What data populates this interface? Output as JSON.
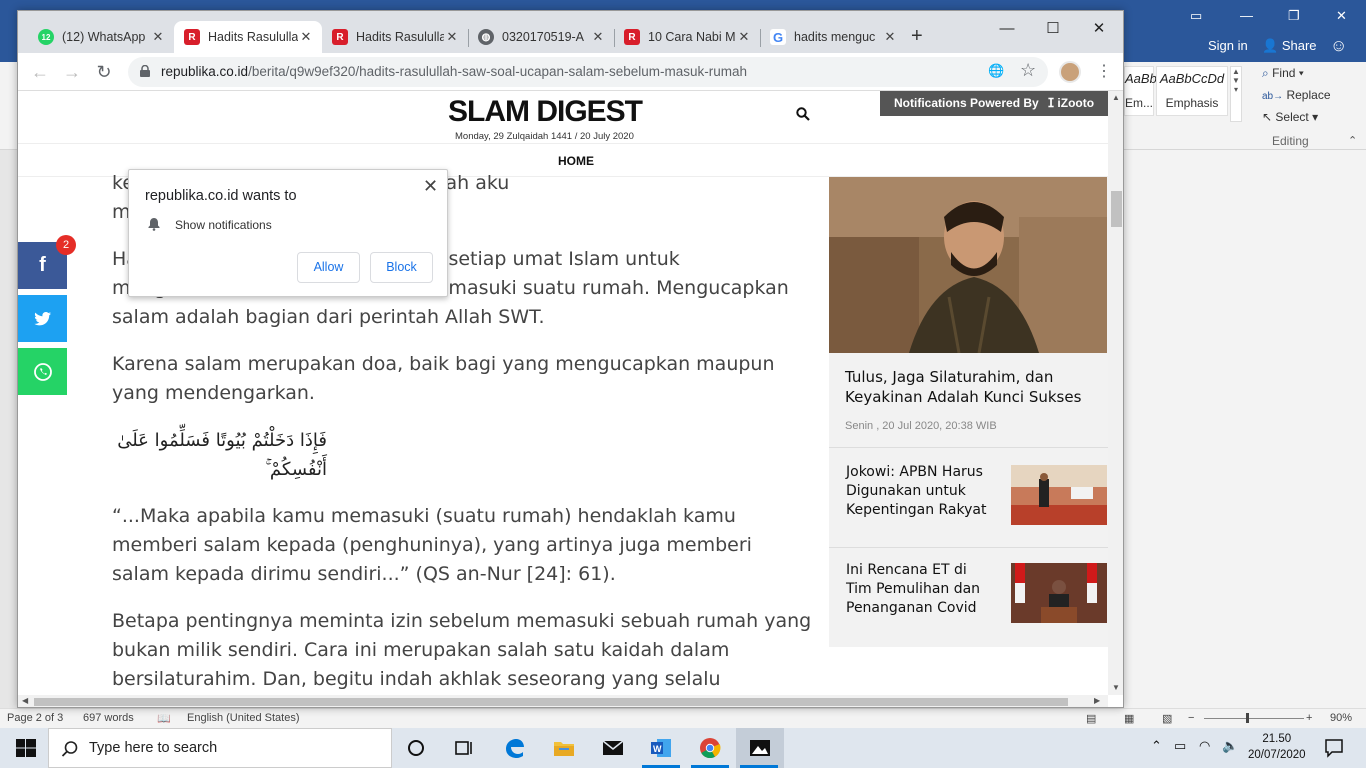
{
  "word": {
    "signin": "Sign in",
    "share": "Share",
    "styles": [
      {
        "sample": "AaBbCcDd",
        "name": "Em..."
      },
      {
        "sample": "AaBbCcDd",
        "name": "Emphasis"
      }
    ],
    "editing": {
      "find": "Find",
      "replace": "Replace",
      "select": "Select",
      "group": "Editing"
    },
    "status": {
      "page": "Page 2 of 3",
      "words": "697 words",
      "language": "English (United States)",
      "zoom": "90%"
    }
  },
  "chrome": {
    "tabs": [
      {
        "label": "(12) WhatsApp",
        "badge": "12",
        "icon": "whatsapp-icon"
      },
      {
        "label": "Hadits Rasululla",
        "icon": "republika-icon"
      },
      {
        "label": "Hadits Rasululla",
        "icon": "republika-icon"
      },
      {
        "label": "0320170519-A",
        "icon": "globe-icon"
      },
      {
        "label": "10 Cara Nabi M",
        "icon": "republika-icon"
      },
      {
        "label": "hadits menguc",
        "icon": "google-icon"
      }
    ],
    "url_domain": "republika.co.id",
    "url_path": "/berita/q9w9ef320/hadits-rasulullah-saw-soal-ucapan-salam-sebelum-masuk-rumah"
  },
  "site": {
    "logo": "SLAM DIGEST",
    "date": "Monday, 29 Zulqaidah 1441 / 20 July 2020",
    "notif_bar": "Notifications Powered By",
    "notif_brand": "iZooto",
    "nav_home": "HOME"
  },
  "popup": {
    "title": "republika.co.id wants to",
    "item": "Show notifications",
    "allow": "Allow",
    "block": "Block"
  },
  "share": {
    "badge": "2"
  },
  "article": {
    "top_line1": "ke… …kan, Assalamualaikum, berkah aku",
    "top_line2": "m…",
    "p1_pre": "Hadits tersebut berisi anjuran bagi setiap umat Islam untuk mengutamakan",
    "p1_link": "salam",
    "p1_post": "sebelum memasuki suatu rumah. Mengucapkan salam adalah bagian dari perintah Allah SWT.",
    "p2": "Karena salam merupakan doa, baik bagi yang mengucapkan maupun yang mendengarkan.",
    "arabic": "فَإِذَا دَخَلْتُمْ بُيُوتًا فَسَلِّمُوا عَلَىٰ أَنْفُسِكُمْ ۚ",
    "p3": "“...Maka apabila kamu memasuki (suatu rumah) hendaklah kamu memberi salam kepada (penghuninya), yang artinya juga memberi salam kepada dirimu sendiri...” (QS an-Nur [24]: 61).",
    "p4": "Betapa pentingnya meminta izin sebelum memasuki sebuah rumah yang bukan milik sendiri. Cara ini merupakan salah satu kaidah dalam bersilaturahim. Dan, begitu indah akhlak seseorang yang selalu mengawali ucapan salam kepada siapa pun yang ditemuinya."
  },
  "sidebar": {
    "hero_title": "Tulus, Jaga Silaturahim, dan Keyakinan Adalah Kunci Sukses",
    "hero_date": "Senin , 20 Jul 2020, 20:38 WIB",
    "items": [
      {
        "title": "Jokowi: APBN Harus Digunakan untuk Kepentingan Rakyat"
      },
      {
        "title": "Ini Rencana ET di Tim Pemulihan dan Penanganan Covid"
      }
    ]
  },
  "taskbar": {
    "search_placeholder": "Type here to search",
    "time": "21.50",
    "date": "20/07/2020"
  }
}
